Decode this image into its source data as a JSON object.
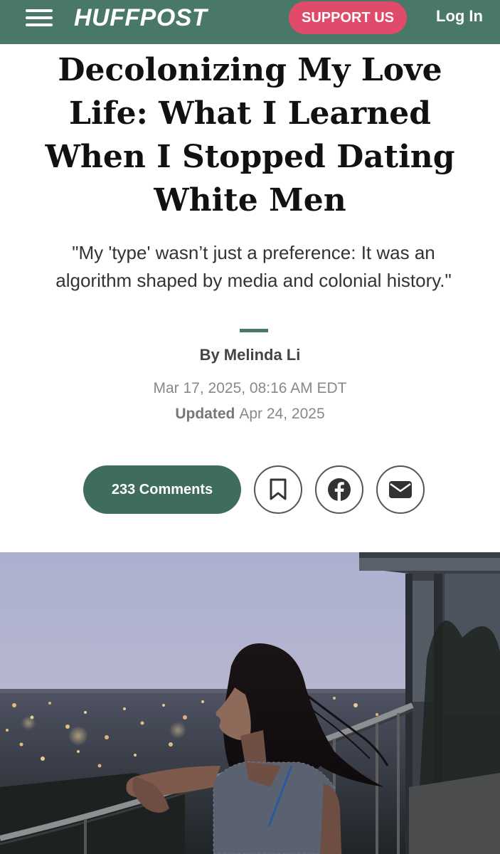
{
  "header": {
    "logo": "HUFFPOST",
    "support_label": "SUPPORT US",
    "login_label": "Log In",
    "bg_color": "#4a7866",
    "support_color": "#e04a6b",
    "menu_icon": "hamburger-menu-icon"
  },
  "article": {
    "headline": "Decolonizing My Love Life: What I Learned When I Stopped Dating White Men",
    "dek": "\"My 'type' wasn’t just a preference: It was an algorithm shaped by media and colonial history.\"",
    "byline_prefix": "By",
    "author": "Melinda Li",
    "published": "Mar 17, 2025, 08:16 AM EDT",
    "updated_label": "Updated",
    "updated_date": "Apr 24, 2025"
  },
  "actions": {
    "comments_label": "233 Comments",
    "save_icon": "bookmark-icon",
    "facebook_icon": "facebook-icon",
    "email_icon": "email-icon",
    "button_color": "#3f6c5c"
  },
  "hero_image": {
    "subject": "woman-on-balcony-at-dusk-photo"
  }
}
